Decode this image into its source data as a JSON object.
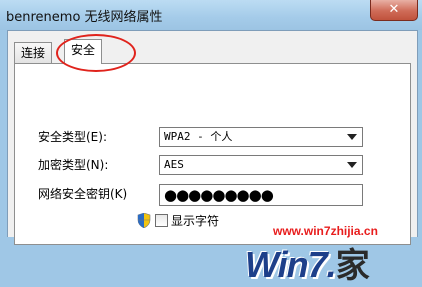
{
  "window": {
    "title": "benrenemo 无线网络属性",
    "close_glyph": "✕"
  },
  "tabs": [
    {
      "label": "连接"
    },
    {
      "label": "安全"
    }
  ],
  "form": {
    "security_type_label": "安全类型(E):",
    "security_type_value": "WPA2 - 个人",
    "encryption_type_label": "加密类型(N):",
    "encryption_type_value": "AES",
    "network_key_label": "网络安全密钥(K)",
    "network_key_value": "●●●●●●●●●",
    "show_chars_label": "显示字符",
    "show_chars_checked": false
  },
  "watermark": {
    "url": "www.win7zhijia.cn",
    "logo_text": "Win7.",
    "logo_char": "家"
  }
}
